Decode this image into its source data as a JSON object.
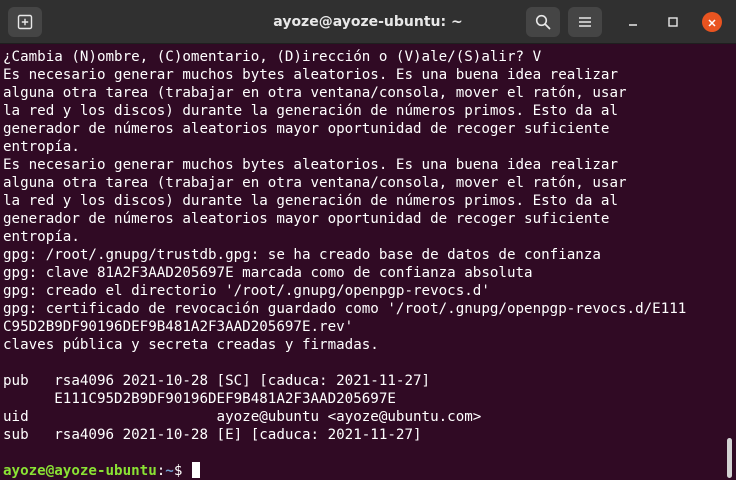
{
  "window": {
    "title": "ayoze@ayoze-ubuntu: ~",
    "icons": {
      "new_tab": "new-tab-icon",
      "search": "search-icon",
      "menu": "hamburger-menu-icon",
      "minimize": "minimize-icon",
      "maximize": "maximize-icon",
      "close": "close-icon"
    },
    "colors": {
      "terminal_bg": "#300a24",
      "titlebar_bg": "#303030",
      "text": "#ffffff",
      "prompt_user": "#8ae234",
      "prompt_path": "#729fcf",
      "close_button": "#e95420"
    }
  },
  "terminal": {
    "lines": [
      "¿Cambia (N)ombre, (C)omentario, (D)irección o (V)ale/(S)alir? V",
      "Es necesario generar muchos bytes aleatorios. Es una buena idea realizar",
      "alguna otra tarea (trabajar en otra ventana/consola, mover el ratón, usar",
      "la red y los discos) durante la generación de números primos. Esto da al",
      "generador de números aleatorios mayor oportunidad de recoger suficiente",
      "entropía.",
      "Es necesario generar muchos bytes aleatorios. Es una buena idea realizar",
      "alguna otra tarea (trabajar en otra ventana/consola, mover el ratón, usar",
      "la red y los discos) durante la generación de números primos. Esto da al",
      "generador de números aleatorios mayor oportunidad de recoger suficiente",
      "entropía.",
      "gpg: /root/.gnupg/trustdb.gpg: se ha creado base de datos de confianza",
      "gpg: clave 81A2F3AAD205697E marcada como de confianza absoluta",
      "gpg: creado el directorio '/root/.gnupg/openpgp-revocs.d'",
      "gpg: certificado de revocación guardado como '/root/.gnupg/openpgp-revocs.d/E111",
      "C95D2B9DF90196DEF9B481A2F3AAD205697E.rev'",
      "claves pública y secreta creadas y firmadas.",
      "",
      "pub   rsa4096 2021-10-28 [SC] [caduca: 2021-11-27]",
      "      E111C95D2B9DF90196DEF9B481A2F3AAD205697E",
      "uid                      ayoze@ubuntu <ayoze@ubuntu.com>",
      "sub   rsa4096 2021-10-28 [E] [caduca: 2021-11-27]",
      ""
    ],
    "prompt": {
      "user_host": "ayoze@ayoze-ubuntu",
      "separator": ":",
      "path": "~",
      "symbol": "$ "
    }
  }
}
